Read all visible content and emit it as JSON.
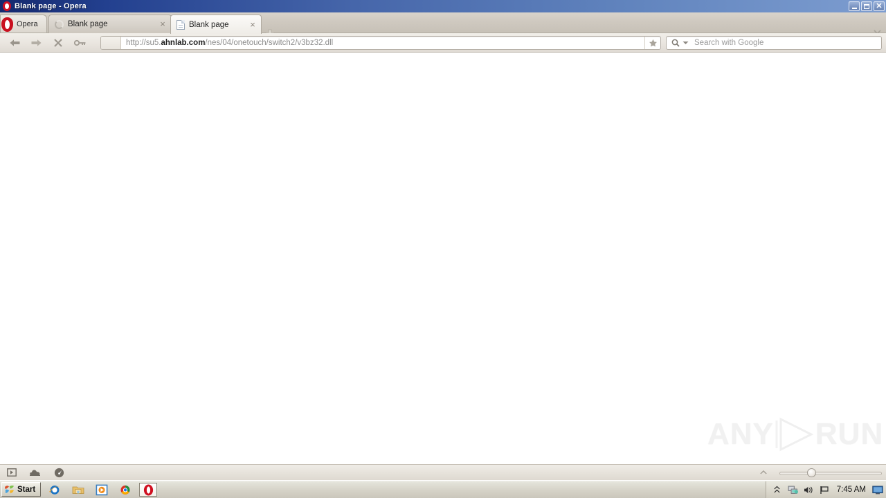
{
  "window": {
    "title": "Blank page - Opera",
    "app_icon": "opera-logo-icon",
    "minimize_label": "_",
    "maximize_label": "❐",
    "close_label": "✕"
  },
  "tabbar": {
    "menu_button_label": "Opera",
    "tabs": [
      {
        "title": "Blank page",
        "favicon": "loading-spinner-icon",
        "active": false,
        "close_label": "×"
      },
      {
        "title": "Blank page",
        "favicon": "blank-page-icon",
        "active": true,
        "close_label": "×"
      }
    ],
    "new_tab_label": "+",
    "tab_list_chevron": "chevron-down-icon"
  },
  "navbar": {
    "back_label": "←",
    "forward_label": "→",
    "stop_label": "✕",
    "wand_label": "wand-icon",
    "address": {
      "full_url": "http://su5.ahnlab.com/nes/04/onetouch/switch2/v3bz32.dll",
      "prefix": "http://su5.",
      "domain": "ahnlab.com",
      "suffix": "/nes/04/onetouch/switch2/v3bz32.dll",
      "bookmark_icon": "star-icon"
    },
    "search": {
      "placeholder": "Search with Google",
      "engine_icon": "magnifier-icon",
      "dropdown_icon": "triangle-down-icon"
    }
  },
  "page": {
    "content": "",
    "watermark": {
      "left_text": "ANY",
      "right_text": "RUN",
      "play_icon": "play-triangle-icon"
    }
  },
  "statusbar": {
    "icons": [
      {
        "name": "panels-toggle-icon"
      },
      {
        "name": "opera-turbo-cloud-icon"
      },
      {
        "name": "speed-gauge-icon"
      }
    ],
    "collapse_chevron": "chevron-up-icon",
    "zoom": {
      "value": "100%",
      "handle_position_percent": 28
    }
  },
  "taskbar": {
    "start_label": "Start",
    "quick_launch": [
      {
        "name": "internet-explorer-icon"
      },
      {
        "name": "file-explorer-icon"
      },
      {
        "name": "media-player-icon"
      },
      {
        "name": "google-chrome-icon"
      },
      {
        "name": "opera-taskbar-icon",
        "active": true
      }
    ],
    "tray": {
      "expand_icon": "double-chevron-up-icon",
      "network_icon": "network-icon",
      "volume_icon": "speaker-icon",
      "security_icon": "flag-icon",
      "time": "7:45 AM",
      "display_icon": "monitor-icon"
    }
  },
  "colors": {
    "titlebar_dark": "#14286e",
    "titlebar_light": "#7d9dd0",
    "opera_red": "#c9101f",
    "chrome_bg": "#cfc9c0",
    "page_bg": "#ffffff",
    "watermark_gray": "#f1f1f1"
  }
}
